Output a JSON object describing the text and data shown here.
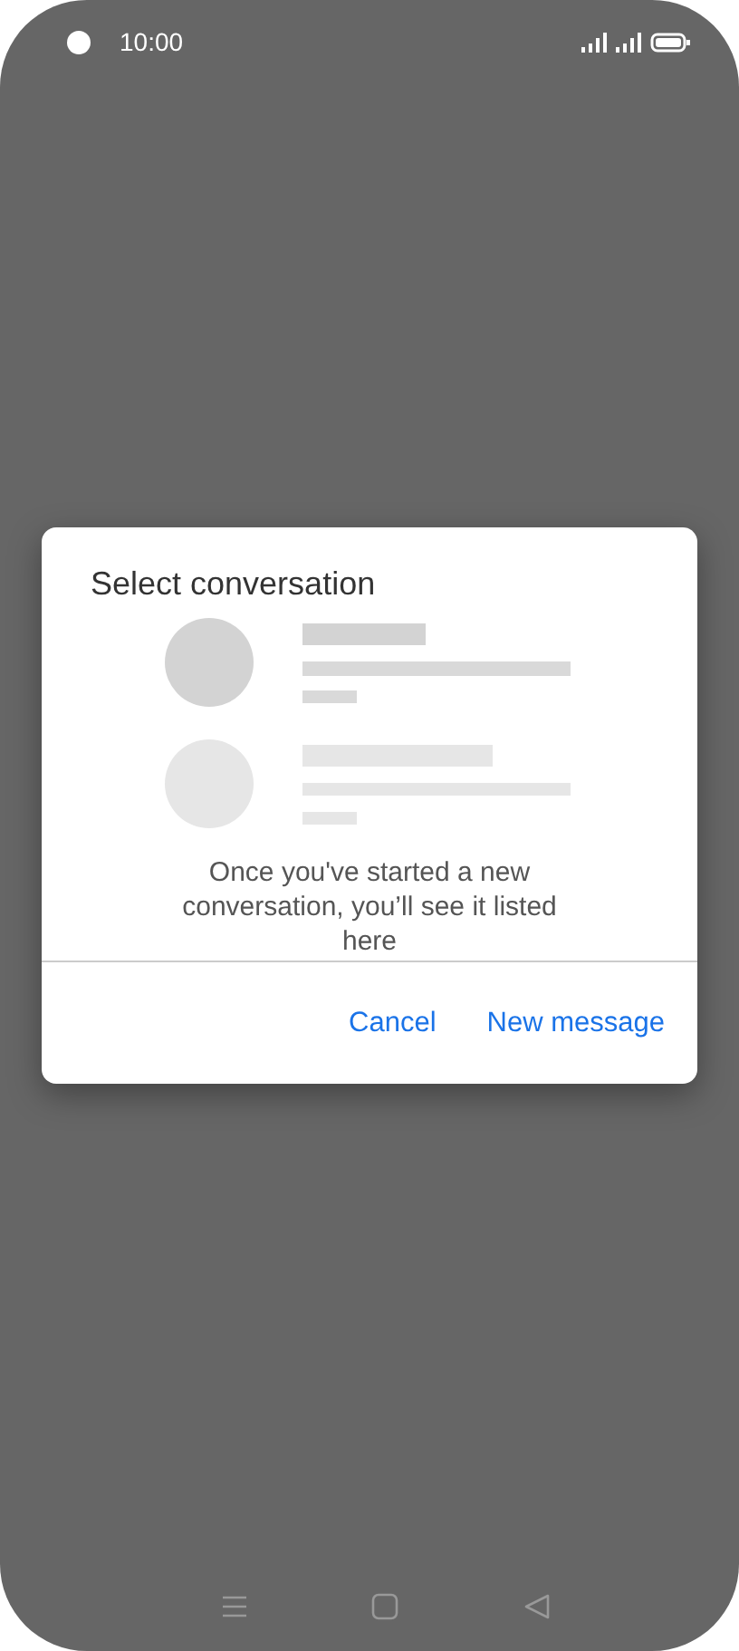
{
  "status_bar": {
    "time": "10:00"
  },
  "dialog": {
    "title": "Select conversation",
    "message": "Once you've started a new conversation, you’ll see it listed here",
    "buttons": [
      "Cancel",
      "New message"
    ]
  }
}
